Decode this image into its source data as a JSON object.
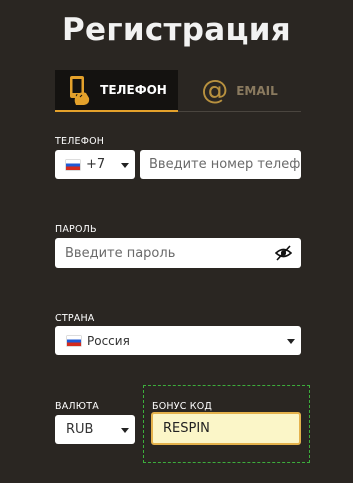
{
  "title": "Регистрация",
  "tabs": {
    "phone_label": "ТЕЛЕФОН",
    "email_label": "EMAIL",
    "active": "phone"
  },
  "phone": {
    "label": "ТЕЛЕФОН",
    "country_code": "+7",
    "placeholder": "Введите номер телефона"
  },
  "password": {
    "label": "ПАРОЛЬ",
    "placeholder": "Введите пароль"
  },
  "country": {
    "label": "СТРАНА",
    "value": "Россия"
  },
  "currency": {
    "label": "ВАЛЮТА",
    "value": "RUB"
  },
  "bonus": {
    "label": "БОНУС КОД",
    "value": "RESPIN"
  },
  "colors": {
    "background": "#2a2622",
    "accent": "#e4a12b",
    "bonus_input_bg": "#fbf6c8",
    "dashed_border": "#3cae3c"
  },
  "icons": {
    "phone_tab": "phone-hand-icon",
    "email_tab": "at-icon",
    "password_toggle": "eye-slash-icon",
    "flag": "russia-flag-icon"
  }
}
